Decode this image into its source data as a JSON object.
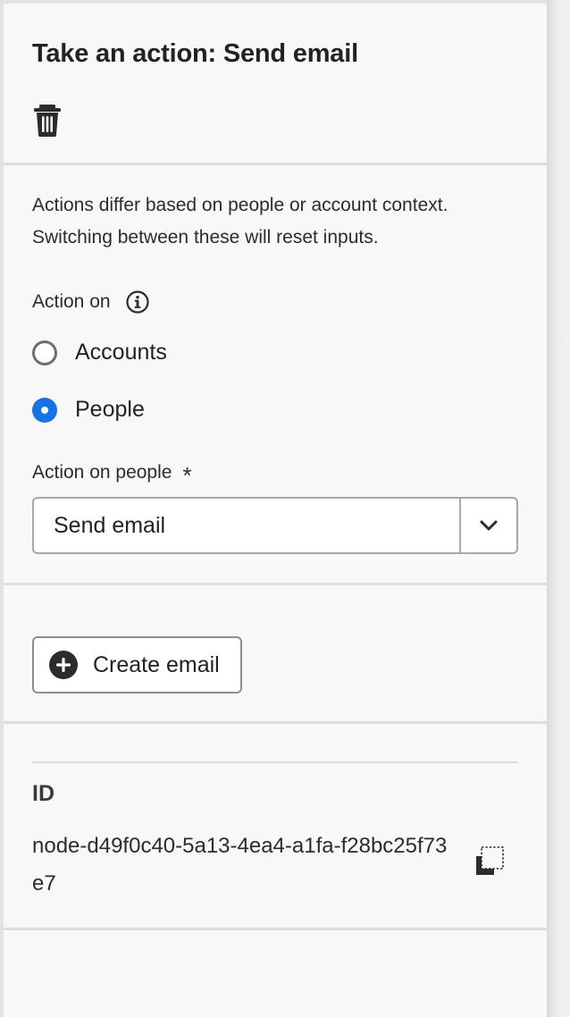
{
  "panel": {
    "title": "Take an action: Send email",
    "delete_icon": "trash-icon"
  },
  "context": {
    "description_line1": "Actions differ based on people or account context.",
    "description_line2": "Switching between these will reset inputs.",
    "action_on_label": "Action on",
    "info_icon": "info-icon",
    "options": [
      {
        "label": "Accounts",
        "selected": false
      },
      {
        "label": "People",
        "selected": true
      }
    ]
  },
  "action_field": {
    "label": "Action on people",
    "required_marker": "*",
    "value": "Send email",
    "dropdown_icon": "chevron-down-icon"
  },
  "create_button": {
    "label": "Create email",
    "icon": "plus-circle-icon"
  },
  "id_section": {
    "heading": "ID",
    "value": "node-d49f0c40-5a13-4ea4-a1fa-f28bc25f73e7",
    "copy_icon": "copy-icon"
  },
  "colors": {
    "accent": "#1473e6",
    "panel_bg": "#f8f8f8",
    "divider": "#dddddd",
    "text": "#222222"
  }
}
